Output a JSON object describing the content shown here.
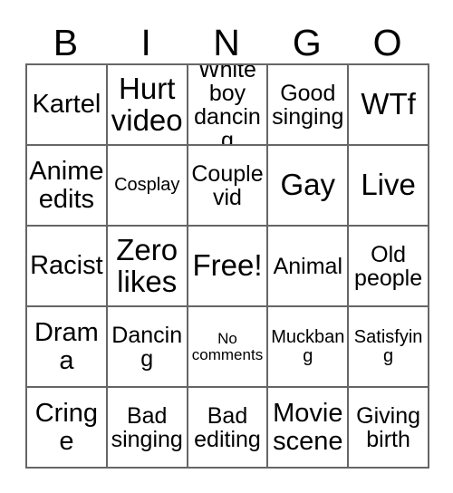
{
  "card": {
    "title": "BINGO",
    "header_letters": [
      "B",
      "I",
      "N",
      "G",
      "O"
    ],
    "rows": [
      [
        {
          "label": "Kartel",
          "size": "lg"
        },
        {
          "label": "Hurt video",
          "size": "xl"
        },
        {
          "label": "White boy dancing",
          "size": "md"
        },
        {
          "label": "Good singing",
          "size": "md"
        },
        {
          "label": "WTf",
          "size": "xl"
        }
      ],
      [
        {
          "label": "Anime edits",
          "size": "lg"
        },
        {
          "label": "Cosplay",
          "size": "sm"
        },
        {
          "label": "Couple vid",
          "size": "md"
        },
        {
          "label": "Gay",
          "size": "xl"
        },
        {
          "label": "Live",
          "size": "xl"
        }
      ],
      [
        {
          "label": "Racist",
          "size": "lg"
        },
        {
          "label": "Zero likes",
          "size": "xl"
        },
        {
          "label": "Free!",
          "size": "xl"
        },
        {
          "label": "Animal",
          "size": "md"
        },
        {
          "label": "Old people",
          "size": "md"
        }
      ],
      [
        {
          "label": "Drama",
          "size": "lg"
        },
        {
          "label": "Dancing",
          "size": "md"
        },
        {
          "label": "No comments",
          "size": "xs"
        },
        {
          "label": "Muckbang",
          "size": "sm"
        },
        {
          "label": "Satisfying",
          "size": "sm"
        }
      ],
      [
        {
          "label": "Cringe",
          "size": "lg"
        },
        {
          "label": "Bad singing",
          "size": "md"
        },
        {
          "label": "Bad editing",
          "size": "md"
        },
        {
          "label": "Movie scene",
          "size": "lg"
        },
        {
          "label": "Giving birth",
          "size": "md"
        }
      ]
    ],
    "free_space": {
      "row": 2,
      "col": 2,
      "label": "Free!"
    },
    "colors": {
      "background": "#ffffff",
      "text": "#000000",
      "grid_line": "#666666"
    }
  }
}
